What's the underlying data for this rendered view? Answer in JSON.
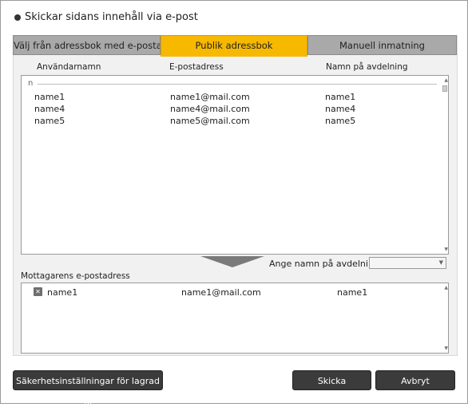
{
  "dialog": {
    "title": "Skickar sidans innehåll via e-post"
  },
  "tabs": [
    {
      "label": "Välj från adressbok med e-postadresser",
      "active": false
    },
    {
      "label": "Publik adressbok",
      "active": true
    },
    {
      "label": "Manuell inmatning",
      "active": false
    }
  ],
  "columns": {
    "username": "Användarnamn",
    "email": "E-postadress",
    "department": "Namn på avdelning"
  },
  "address_list": {
    "group_label": "n",
    "rows": [
      {
        "name": "name1",
        "email": "name1@mail.com",
        "department": "name1"
      },
      {
        "name": "name4",
        "email": "name4@mail.com",
        "department": "name4"
      },
      {
        "name": "name5",
        "email": "name5@mail.com",
        "department": "name5"
      }
    ]
  },
  "department_filter": {
    "label": "Ange namn på avdelning:",
    "value": ""
  },
  "recipients": {
    "label": "Mottagarens e-postadress",
    "rows": [
      {
        "name": "name1",
        "email": "name1@mail.com",
        "department": "name1"
      }
    ]
  },
  "buttons": {
    "security": "Säkerhetsinställningar för lagrad fil",
    "send": "Skicka",
    "cancel": "Avbryt"
  },
  "colors": {
    "active_tab": "#f7b800",
    "button_bg": "#3b3b3b"
  }
}
